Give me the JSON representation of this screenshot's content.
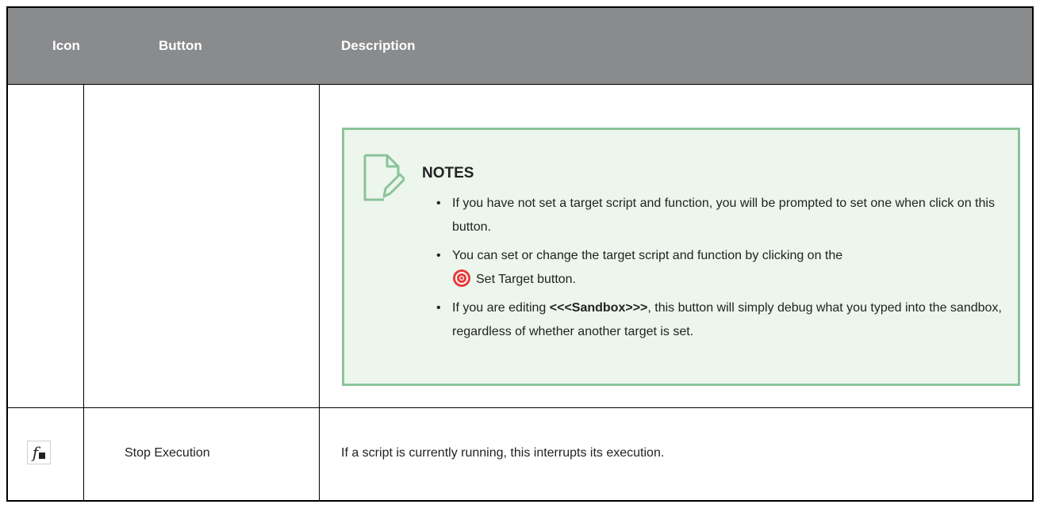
{
  "header": {
    "col_icon": "Icon",
    "col_button": "Button",
    "col_description": "Description"
  },
  "notes": {
    "title": "NOTES",
    "icon": "note-edit-icon",
    "accent_color": "#8cc39a",
    "background_color": "#ecf6ec",
    "bullets": {
      "b1": "If you have not set a target script and function, you will be prompted to set one when click on this button.",
      "b2_before": "You can set or change the target script and function by clicking on the",
      "b2_icon": "target-icon",
      "b2_after": "Set Target button.",
      "b3_before": "If you are editing ",
      "b3_bold": "<<<Sandbox>>>",
      "b3_after": ", this button will simply debug what you typed into the sandbox, regardless of whether another target is set."
    }
  },
  "row_stop": {
    "icon": "function-stop-icon",
    "button": "Stop Execution",
    "description": "If a script is currently running, this interrupts its execution."
  },
  "colors": {
    "header_bg": "#8a8b8d",
    "target_red": "#e63b3b"
  }
}
